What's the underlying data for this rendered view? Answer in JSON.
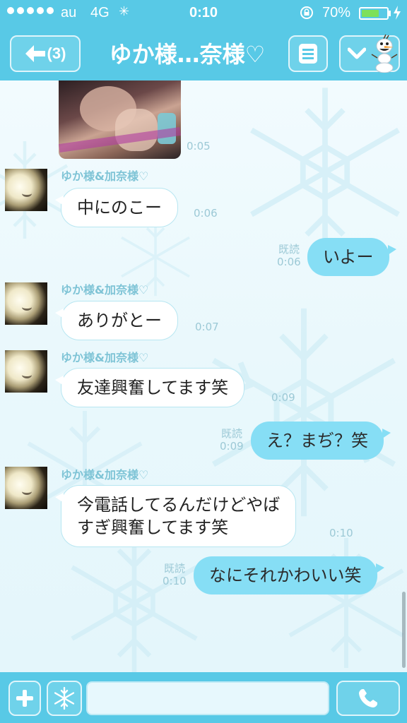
{
  "status_bar": {
    "carrier": "au",
    "network": "4G",
    "time": "0:10",
    "battery_percent": "70%",
    "battery_level": 0.7
  },
  "header": {
    "unread_count": "(3)",
    "title": "ゆか様…奈様♡",
    "back_icon": "arrow-left-icon",
    "menu_icon": "list-icon",
    "expand_icon": "chevron-down-icon",
    "mascot_icon": "snowman-icon"
  },
  "messages": [
    {
      "side": "in",
      "type": "photo",
      "time": "0:05"
    },
    {
      "side": "in",
      "sender": "ゆか様&加奈様♡",
      "lines": [
        "中にのこー"
      ],
      "time": "0:06"
    },
    {
      "side": "out",
      "read": "既読",
      "lines": [
        "いよー"
      ],
      "time": "0:06"
    },
    {
      "side": "in",
      "sender": "ゆか様&加奈様♡",
      "lines": [
        "ありがとー"
      ],
      "time": "0:07"
    },
    {
      "side": "in",
      "sender": "ゆか様&加奈様♡",
      "lines": [
        "友達興奮してます笑"
      ],
      "time": "0:09"
    },
    {
      "side": "out",
      "read": "既読",
      "lines": [
        "え？まぢ？笑"
      ],
      "time": "0:09"
    },
    {
      "side": "in",
      "sender": "ゆか様&加奈様♡",
      "lines": [
        "今電話してるんだけどやば",
        "すぎ興奮してます笑"
      ],
      "time": "0:10"
    },
    {
      "side": "out",
      "read": "既読",
      "lines": [
        "なにそれかわいい笑"
      ],
      "time": "0:10"
    }
  ],
  "input": {
    "placeholder": "",
    "value": ""
  },
  "bottom_bar": {
    "plus_icon": "plus-icon",
    "sticker_icon": "snowflake-icon",
    "call_icon": "phone-icon"
  },
  "colors": {
    "bar": "#58c9e6",
    "outgoing_bubble": "#86def5",
    "incoming_bubble": "#ffffff",
    "background": "#eef9fc"
  }
}
